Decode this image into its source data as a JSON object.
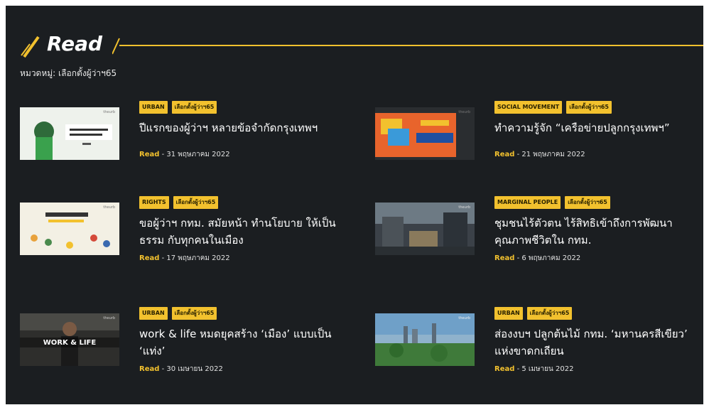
{
  "section": {
    "title": "Read",
    "category": "หมวดหมู่: เลือกตั้งผู้ว่าฯ65"
  },
  "colors": {
    "accent": "#f2c12e",
    "background": "#1b1e21",
    "text": "#ffffff"
  },
  "articles": [
    {
      "tags": [
        "URBAN",
        "เลือกตั้งผู้ว่าฯ65"
      ],
      "title": "ปีแรกของผู้ว่าฯ หลายข้อจำกัดกรุงเทพฯ",
      "source": "Read",
      "sep": " - ",
      "date": "31 พฤษภาคม 2022",
      "thumb_text": "1 ปีของผู้ว่าฯ หลายข้อจำกัดกรุงเทพฯ"
    },
    {
      "tags": [
        "SOCIAL MOVEMENT",
        "เลือกตั้งผู้ว่าฯ65"
      ],
      "title": "ทำความรู้จัก “เครือข่ายปลูกกรุงเทพฯ”",
      "source": "Read",
      "sep": " - ",
      "date": "21 พฤษภาคม 2022",
      "thumb_text": "ปลูกกรุงเทพฯ"
    },
    {
      "tags": [
        "RIGHTS",
        "เลือกตั้งผู้ว่าฯ65"
      ],
      "title": "ขอผู้ว่าฯ กทม. สมัยหน้า ทำนโยบาย ให้เป็นธรรม กับทุกคนในเมือง",
      "source": "Read",
      "sep": " - ",
      "date": "17 พฤษภาคม 2022",
      "thumb_text": "ขอผู้ว่าฯ กทม. สมัยหน้า"
    },
    {
      "tags": [
        "MARGINAL PEOPLE",
        "เลือกตั้งผู้ว่าฯ65"
      ],
      "title": "ชุมชนไร้ตัวตน ไร้สิทธิเข้าถึงการพัฒนาคุณภาพชีวิตใน กทม.",
      "source": "Read",
      "sep": " - ",
      "date": "6 พฤษภาคม 2022",
      "thumb_text": ""
    },
    {
      "tags": [
        "URBAN",
        "เลือกตั้งผู้ว่าฯ65"
      ],
      "title": "work & life หมดยุคสร้าง ‘เมือง’ แบบเป็น ‘แท่ง’",
      "source": "Read",
      "sep": " - ",
      "date": "30 เมษายน 2022",
      "thumb_text": "WORK & LIFE"
    },
    {
      "tags": [
        "URBAN",
        "เลือกตั้งผู้ว่าฯ65"
      ],
      "title": "ส่องงบฯ ปลูกต้นไม้ กทม. ‘มหานครสีเขียว’ แห่งขาดกเถียน",
      "source": "Read",
      "sep": " - ",
      "date": "5 เมษายน 2022",
      "thumb_text": ""
    }
  ]
}
